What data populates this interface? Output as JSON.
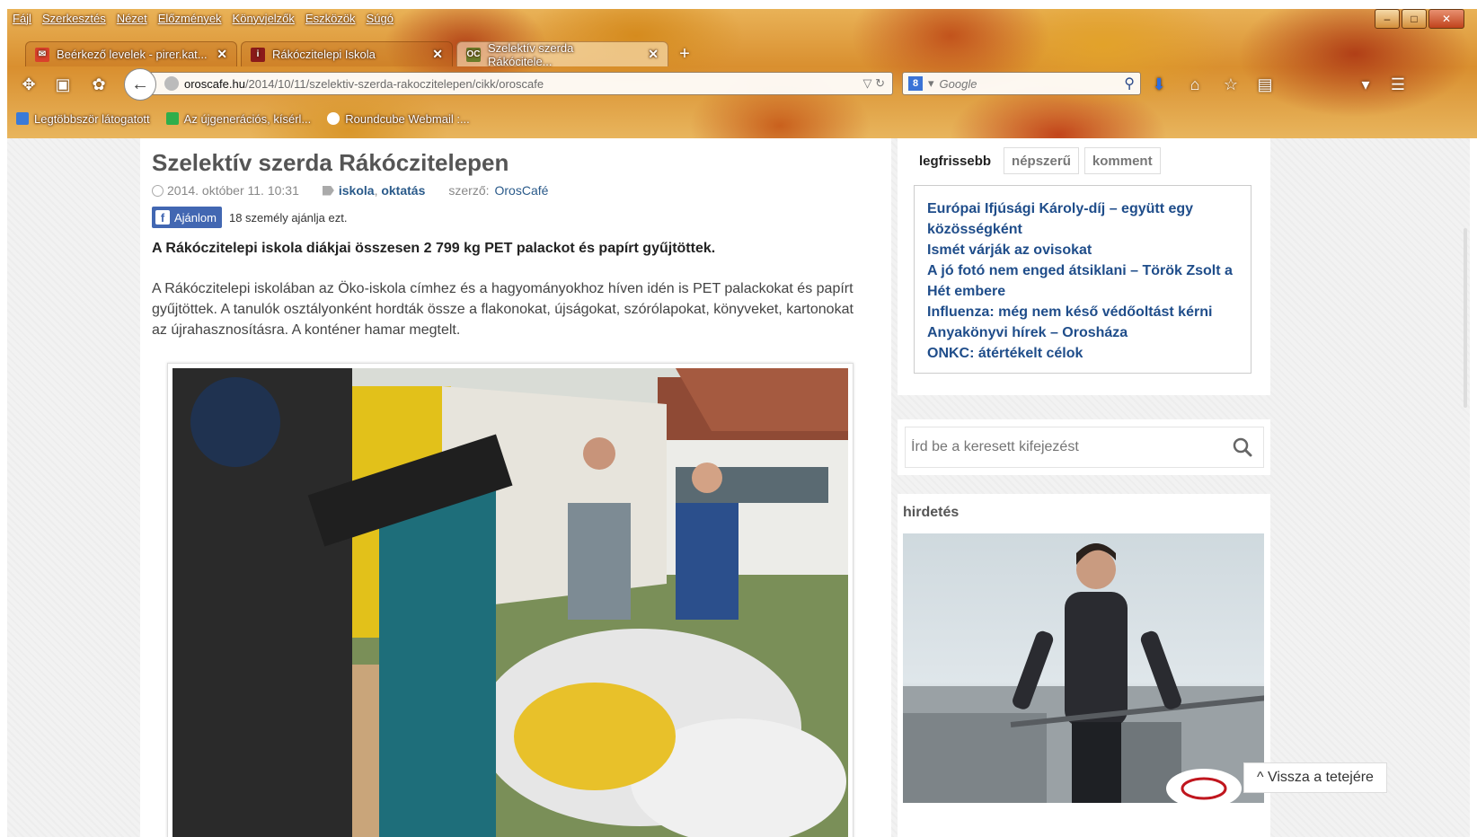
{
  "menu": [
    "Fájl",
    "Szerkesztés",
    "Nézet",
    "Előzmények",
    "Könyvjelzők",
    "Eszközök",
    "Súgó"
  ],
  "tabs": [
    {
      "label": "Beérkező levelek - pirer.kat...",
      "icon": "gmail-icon"
    },
    {
      "label": "Rákóczitelepi Iskola",
      "icon": "school-icon"
    },
    {
      "label": "Szelektív szerda Rákócitele...",
      "icon": "oc-icon"
    }
  ],
  "url": {
    "domain": "oroscafe.hu",
    "path": "/2014/10/11/szelektiv-szerda-rakoczitelepen/cikk/oroscafe"
  },
  "search": {
    "engine_label": "Google"
  },
  "bookmarks": [
    "Legtöbbször látogatott",
    "Az újgenerációs, kísérl...",
    "Roundcube Webmail :..."
  ],
  "article": {
    "title": "Szelektív szerda Rákóczitelepen",
    "date": "2014. október 11. 10:31",
    "tags": [
      "iskola",
      "oktatás"
    ],
    "author_label": "szerző:",
    "author": "OrosCafé",
    "fb_button": "Ajánlom",
    "fb_count_text": "18 személy ajánlja ezt.",
    "lead": "A Rákóczitelepi iskola diákjai összesen 2 799 kg PET palackot és papírt gyűjtöttek.",
    "body": "A Rákóczitelepi iskolában az Öko-iskola címhez és a hagyományokhoz híven idén is PET palackokat és papírt gyűjtöttek. A tanulók osztályonként hordták össze a flakonokat, újságokat, szórólapokat, könyveket, kartonokat az újrahasznosításra. A konténer hamar megtelt."
  },
  "sidebar": {
    "tabs": [
      "legfrissebb",
      "népszerű",
      "komment"
    ],
    "news": [
      "Európai Ifjúsági Károly-díj – együtt egy közösségként",
      "Ismét várják az ovisokat",
      "A jó fotó nem enged átsiklani – Török Zsolt a Hét embere",
      "Influenza: még nem késő védőoltást kérni",
      "Anyakönyvi hírek – Orosháza",
      "ONKC: átértékelt célok"
    ],
    "search_placeholder": "Írd be a keresett kifejezést",
    "ad_label": "hirdetés",
    "back_to_top": "^ Vissza a tetejére"
  }
}
